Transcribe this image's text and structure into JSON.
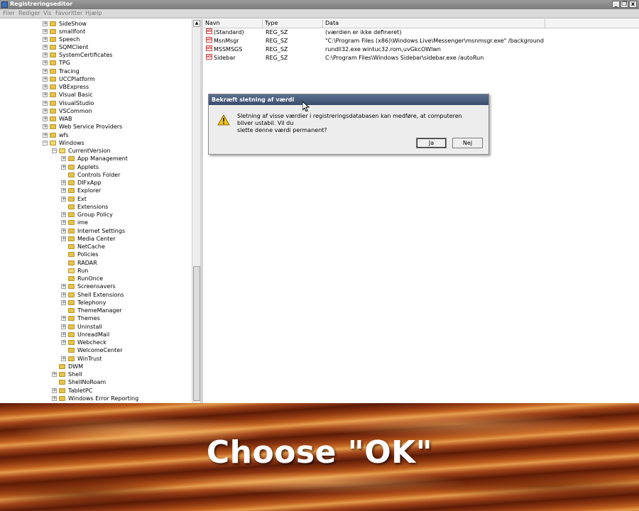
{
  "window": {
    "title": "Registreringseditor",
    "buttons": {
      "minimize": "_",
      "maximize": "❐",
      "close": "x"
    }
  },
  "menu": [
    "Filer",
    "Rediger",
    "Vis",
    "Favoritter",
    "Hjælp"
  ],
  "tree": {
    "items": [
      {
        "label": "SideShow"
      },
      {
        "label": "smallfont"
      },
      {
        "label": "Speech"
      },
      {
        "label": "SQMClient"
      },
      {
        "label": "SystemCertificates"
      },
      {
        "label": "TPG"
      },
      {
        "label": "Tracing"
      },
      {
        "label": "UCCPlatform"
      },
      {
        "label": "VBExpress"
      },
      {
        "label": "Visual Basic"
      },
      {
        "label": "VisualStudio"
      },
      {
        "label": "VSCommon"
      },
      {
        "label": "WAB"
      },
      {
        "label": "Web Service Providers"
      },
      {
        "label": "wfs"
      },
      {
        "label": "Windows"
      },
      {
        "label": "CurrentVersion"
      },
      {
        "label": "App Management"
      },
      {
        "label": "Applets"
      },
      {
        "label": "Controls Folder"
      },
      {
        "label": "DIFxApp"
      },
      {
        "label": "Explorer"
      },
      {
        "label": "Ext"
      },
      {
        "label": "Extensions"
      },
      {
        "label": "Group Policy"
      },
      {
        "label": "ime"
      },
      {
        "label": "Internet Settings"
      },
      {
        "label": "Media Center"
      },
      {
        "label": "NetCache"
      },
      {
        "label": "Policies"
      },
      {
        "label": "RADAR"
      },
      {
        "label": "Run"
      },
      {
        "label": "RunOnce"
      },
      {
        "label": "Screensavers"
      },
      {
        "label": "Shell Extensions"
      },
      {
        "label": "Telephony"
      },
      {
        "label": "ThemeManager"
      },
      {
        "label": "Themes"
      },
      {
        "label": "Uninstall"
      },
      {
        "label": "UnreadMail"
      },
      {
        "label": "Webcheck"
      },
      {
        "label": "WelcomeCenter"
      },
      {
        "label": "WinTrust"
      },
      {
        "label": "DWM"
      },
      {
        "label": "Shell"
      },
      {
        "label": "ShellNoRoam"
      },
      {
        "label": "TabletPC"
      },
      {
        "label": "Windows Error Reporting"
      }
    ]
  },
  "list": {
    "columns": [
      "Navn",
      "Type",
      "Data"
    ],
    "rows": [
      {
        "name": "(Standard)",
        "type": "REG_SZ",
        "data": "(værdien er ikke defineret)"
      },
      {
        "name": "MsnMsgr",
        "type": "REG_SZ",
        "data": "\"C:\\Program Files (x86)\\Windows Live\\Messenger\\msnmsgr.exe\" /background"
      },
      {
        "name": "MSSMSGS",
        "type": "REG_SZ",
        "data": "rundll32.exe wintuc32.rom,uvGkcOWlwn"
      },
      {
        "name": "Sidebar",
        "type": "REG_SZ",
        "data": "C:\\Program Files\\Windows Sidebar\\sidebar.exe /autoRun"
      }
    ],
    "value_icon": "ab"
  },
  "dialog": {
    "title": "Bekræft sletning af værdi",
    "message_line1": "Sletning af visse værdier i registreringsdatabasen kan medføre, at computeren bliver ustabil. Vil du",
    "message_line2": "slette denne værdi permanent?",
    "yes_label": "Ja",
    "no_label": "Nej"
  },
  "caption": "Choose \"OK\""
}
